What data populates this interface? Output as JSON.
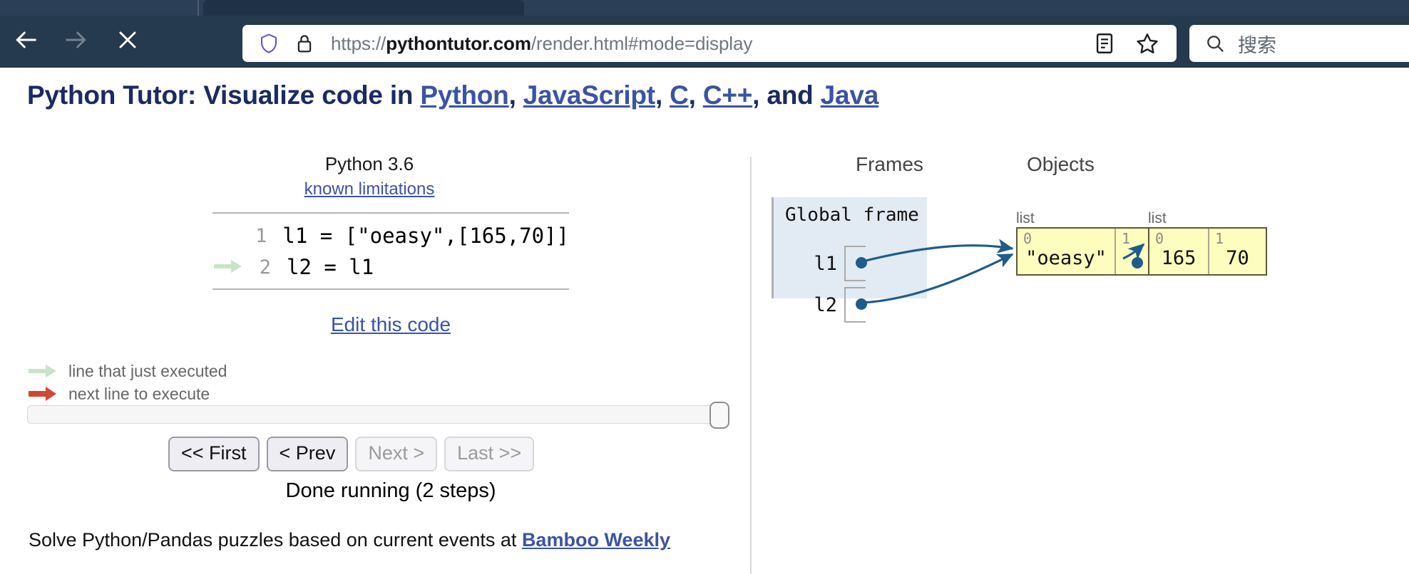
{
  "browser": {
    "back_icon": "back-arrow-icon",
    "forward_icon": "forward-arrow-icon",
    "stop_icon": "stop-x-icon",
    "shield_icon": "shield-icon",
    "lock_icon": "lock-icon",
    "url_prefix": "https://",
    "url_host": "pythontutor.com",
    "url_path": "/render.html#mode=display",
    "url_full": "https://pythontutor.com/render.html#mode=display",
    "reader_icon": "reader-view-icon",
    "bookmark_icon": "bookmark-star-icon",
    "search_icon": "search-icon",
    "search_placeholder": "搜索",
    "chrome_color": "#25394f",
    "tabstrip_color": "#2b3f56"
  },
  "page": {
    "title_prefix": "Python Tutor: Visualize code in ",
    "title_links": [
      "Python",
      "JavaScript",
      "C",
      "C++",
      "Java"
    ],
    "title_sep": ", ",
    "title_and": ", and ",
    "title_color": "#1b2a63",
    "link_color": "#3a53a4"
  },
  "editor": {
    "python_version": "Python 3.6",
    "known_limitations": "known limitations",
    "edit_link": "Edit this code",
    "lines": [
      {
        "number": "1",
        "text": "l1 = [\"oeasy\",[165,70]]",
        "marker": "none"
      },
      {
        "number": "2",
        "text": "l2 = l1",
        "marker": "executed"
      }
    ]
  },
  "legend": {
    "items": [
      {
        "label": "line that just executed",
        "color": "#c8e4c8",
        "icon": "green-arrow-icon"
      },
      {
        "label": "next line to execute",
        "color": "#d14836",
        "icon": "red-arrow-icon"
      }
    ]
  },
  "controls": {
    "slider_value": 100,
    "buttons": [
      {
        "label": "<< First",
        "enabled": true
      },
      {
        "label": "< Prev",
        "enabled": true
      },
      {
        "label": "Next >",
        "enabled": false
      },
      {
        "label": "Last >>",
        "enabled": false
      }
    ],
    "status": "Done running (2 steps)"
  },
  "footer": {
    "text_before": "Solve Python/Pandas puzzles based on current events at ",
    "link": "Bamboo Weekly"
  },
  "viz": {
    "frames_header": "Frames",
    "objects_header": "Objects",
    "frame_name": "Global frame",
    "variables": [
      {
        "name": "l1",
        "points_to": "list-1"
      },
      {
        "name": "l2",
        "points_to": "list-1"
      }
    ],
    "objects": [
      {
        "id": "list-1",
        "type_label": "list",
        "cells": [
          {
            "index": "0",
            "value": "\"oeasy\"",
            "is_pointer": false
          },
          {
            "index": "1",
            "value": "",
            "is_pointer": true,
            "points_to": "list-2"
          }
        ]
      },
      {
        "id": "list-2",
        "type_label": "list",
        "cells": [
          {
            "index": "0",
            "value": "165",
            "is_pointer": false
          },
          {
            "index": "1",
            "value": "70",
            "is_pointer": false
          }
        ]
      }
    ],
    "frame_bg": "#e2eaf4",
    "object_bg": "#fdfdbe",
    "pointer_color": "#1f5c8b"
  }
}
